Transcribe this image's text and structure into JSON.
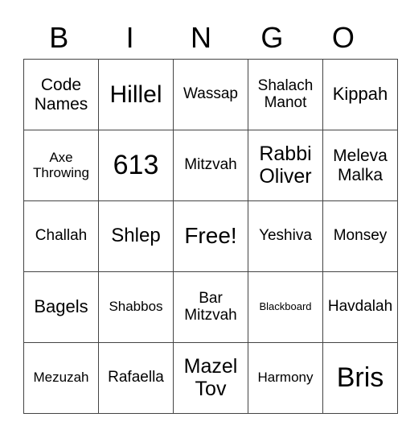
{
  "header": [
    "B",
    "I",
    "N",
    "G",
    "O"
  ],
  "rows": [
    [
      "Code Names",
      "Hillel",
      "Wassap",
      "Shalach Manot",
      "Kippah"
    ],
    [
      "Axe Throwing",
      "613",
      "Mitzvah",
      "Rabbi Oliver",
      "Meleva Malka"
    ],
    [
      "Challah",
      "Shlep",
      "Free!",
      "Yeshiva",
      "Monsey"
    ],
    [
      "Bagels",
      "Shabbos",
      "Bar Mitzvah",
      "Blackboard",
      "Havdalah"
    ],
    [
      "Mezuzah",
      "Rafaella",
      "Mazel Tov",
      "Harmony",
      "Bris"
    ]
  ]
}
